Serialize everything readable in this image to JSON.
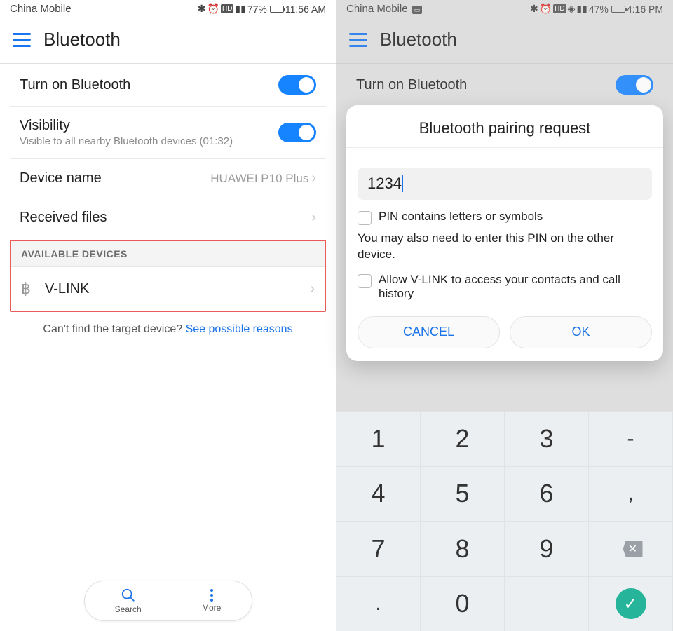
{
  "left": {
    "status": {
      "carrier": "China Mobile",
      "battery_pct": "77%",
      "time": "11:56 AM"
    },
    "titlebar": {
      "title": "Bluetooth"
    },
    "rows": {
      "bt_toggle_label": "Turn on Bluetooth",
      "visibility_label": "Visibility",
      "visibility_sub": "Visible to all nearby Bluetooth devices (01:32)",
      "device_name_label": "Device name",
      "device_name_value": "HUAWEI P10 Plus",
      "received_files_label": "Received files"
    },
    "section_header": "AVAILABLE DEVICES",
    "device": {
      "name": "V-LINK"
    },
    "hint_text": "Can't find the target device? ",
    "hint_link": "See possible reasons",
    "bottom_pill": {
      "search": "Search",
      "more": "More"
    }
  },
  "right": {
    "status": {
      "carrier": "China Mobile",
      "battery_pct": "47%",
      "time": "4:16 PM"
    },
    "titlebar": {
      "title": "Bluetooth"
    },
    "bg_row_label": "Turn on Bluetooth",
    "dialog": {
      "title": "Bluetooth pairing request",
      "pin_value": "1234",
      "check1_label": "PIN contains letters or symbols",
      "note": "You may also need to enter this PIN on the other device.",
      "check2_label": "Allow V-LINK to access your contacts and call history",
      "cancel": "CANCEL",
      "ok": "OK"
    },
    "keypad": {
      "r1": [
        "1",
        "2",
        "3",
        "-"
      ],
      "r2": [
        "4",
        "5",
        "6",
        ","
      ],
      "r3": [
        "7",
        "8",
        "9",
        "⌫"
      ],
      "r4": [
        ".",
        "0",
        "",
        ""
      ]
    }
  }
}
